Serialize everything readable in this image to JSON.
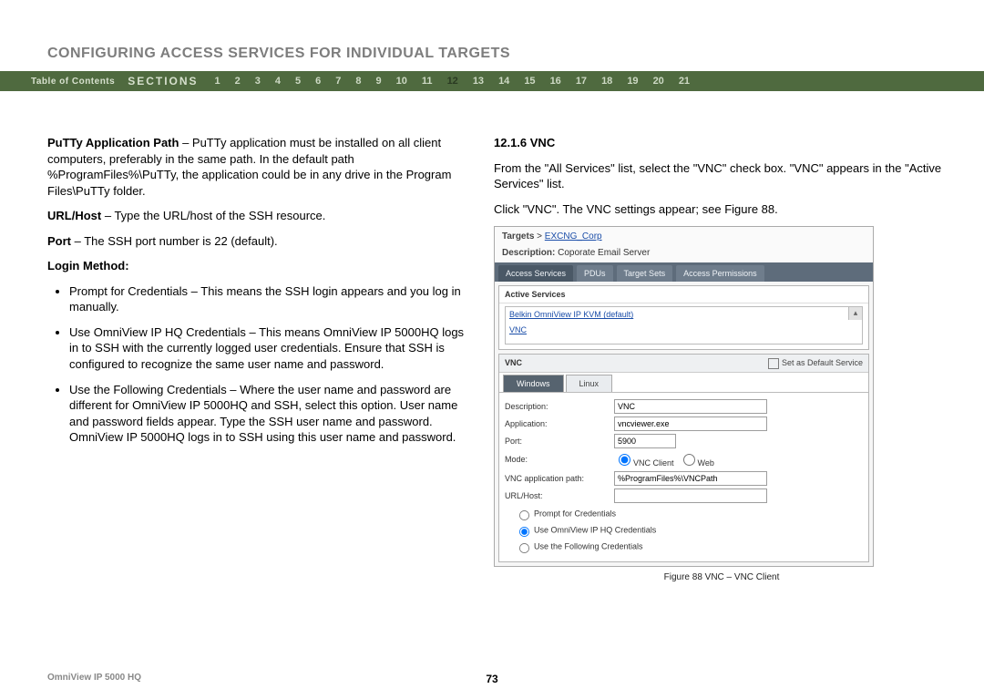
{
  "page_title": "CONFIGURING ACCESS SERVICES FOR INDIVIDUAL TARGETS",
  "nav": {
    "toc_label": "Table of Contents",
    "sections_label": "SECTIONS",
    "items": [
      "1",
      "2",
      "3",
      "4",
      "5",
      "6",
      "7",
      "8",
      "9",
      "10",
      "11",
      "12",
      "13",
      "14",
      "15",
      "16",
      "17",
      "18",
      "19",
      "20",
      "21"
    ],
    "current": "12"
  },
  "left": {
    "putty_label": "PuTTy Application Path",
    "putty_text": " – PuTTy application must be installed on all client computers, preferably in the same path. In the default path %ProgramFiles%\\PuTTy, the application could be in any drive in the Program Files\\PuTTy folder.",
    "url_label": "URL/Host",
    "url_text": " – Type the URL/host of the SSH resource.",
    "port_label": "Port",
    "port_text": " – The SSH port number is 22 (default).",
    "login_head": "Login Method:",
    "bullets": [
      "Prompt for Credentials – This means the SSH login appears and you log in manually.",
      "Use OmniView IP HQ Credentials – This means OmniView IP 5000HQ logs in to SSH with the currently logged user credentials. Ensure that SSH is configured to recognize the same user name and password.",
      "Use the Following Credentials – Where the user name and password are different for OmniView IP 5000HQ and SSH, select this option. User name and password fields appear. Type the SSH user name and password. OmniView IP 5000HQ logs in to SSH using this user name and password."
    ]
  },
  "right": {
    "heading": "12.1.6 VNC",
    "p1": "From the \"All Services\" list, select the \"VNC\" check box. \"VNC\" appears in the \"Active Services\" list.",
    "p2": "Click \"VNC\". The VNC settings appear; see Figure 88."
  },
  "figure": {
    "targets_label": "Targets",
    "breadcrumb_target": "EXCNG_Corp",
    "desc_label": "Description:",
    "desc_value": "Coporate Email Server",
    "tabs": [
      "Access Services",
      "PDUs",
      "Target Sets",
      "Access Permissions"
    ],
    "active_services_label": "Active Services",
    "active_list": [
      "Belkin OmniView IP KVM (default)",
      "VNC"
    ],
    "vnc_label": "VNC",
    "set_default_label": "Set as Default Service",
    "subtabs": [
      "Windows",
      "Linux"
    ],
    "fields": {
      "description_label": "Description:",
      "description_value": "VNC",
      "application_label": "Application:",
      "application_value": "vncviewer.exe",
      "port_label": "Port:",
      "port_value": "5900",
      "mode_label": "Mode:",
      "mode_vnc_client": "VNC Client",
      "mode_web": "Web",
      "vnc_path_label": "VNC application path:",
      "vnc_path_value": "%ProgramFiles%\\VNCPath",
      "urlhost_label": "URL/Host:"
    },
    "cred_options": [
      "Prompt for Credentials",
      "Use OmniView IP HQ Credentials",
      "Use the Following Credentials"
    ],
    "caption": "Figure 88 VNC – VNC Client"
  },
  "footer": {
    "product": "OmniView IP 5000 HQ",
    "page_number": "73"
  }
}
